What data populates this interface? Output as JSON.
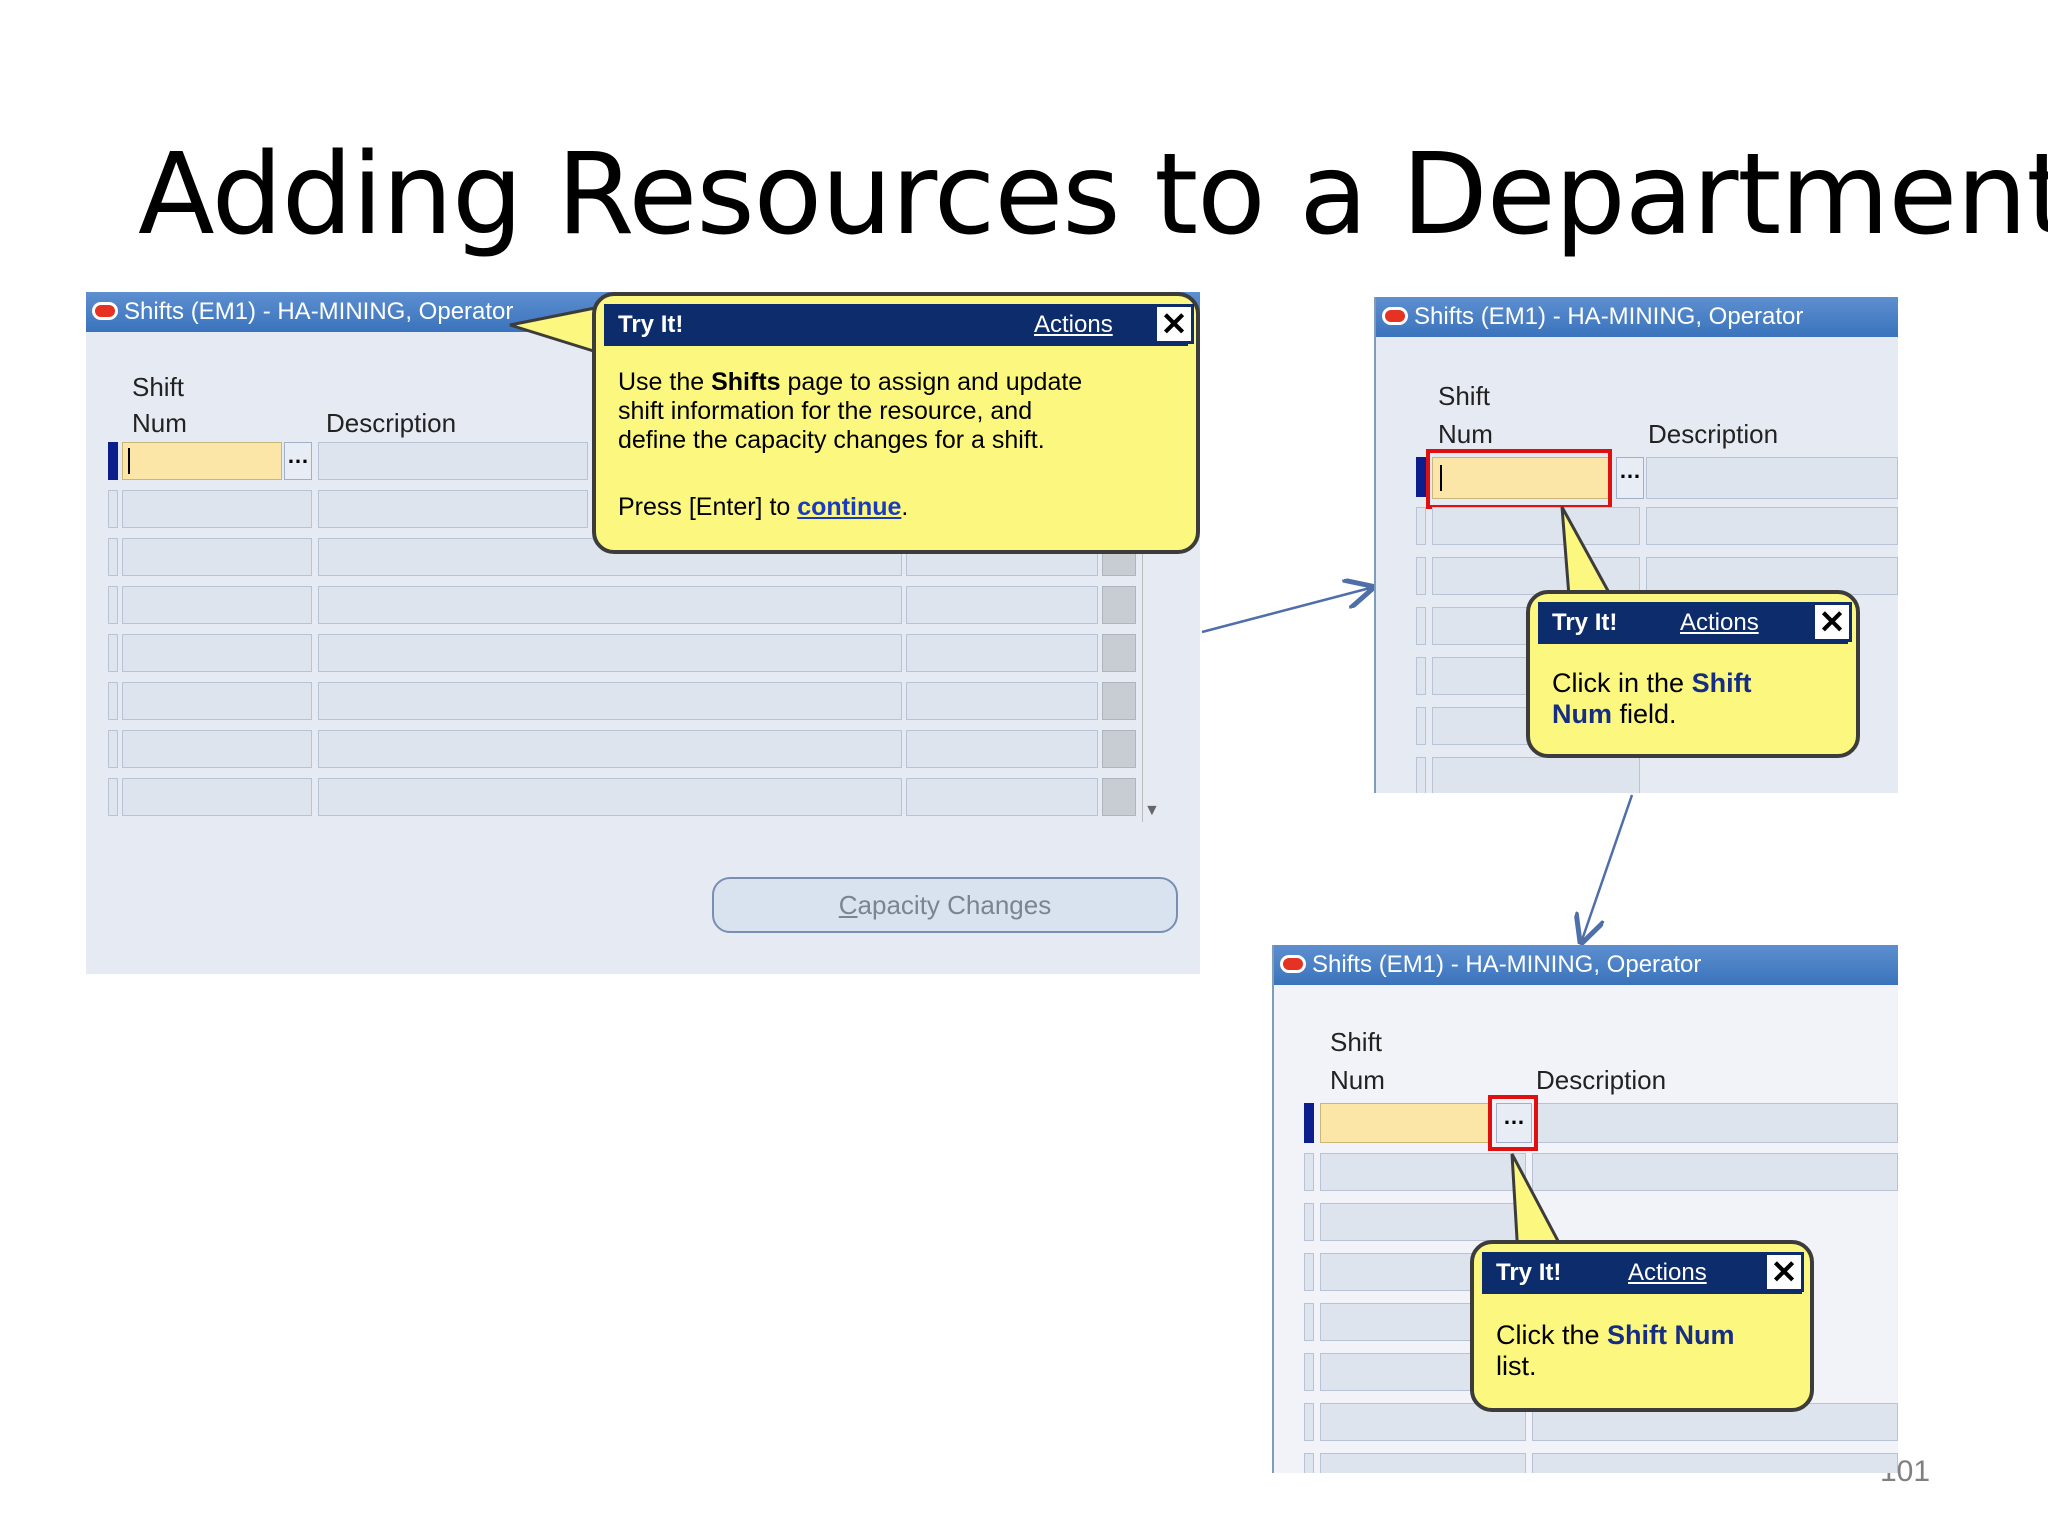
{
  "slide": {
    "title": "Adding Resources to a Department",
    "page_number": "101"
  },
  "window": {
    "title": "Shifts (EM1) - HA-MINING, Operator"
  },
  "columns": {
    "shift": "Shift",
    "num": "Num",
    "description": "Description"
  },
  "lov_button": "…",
  "capacity_button": {
    "prefix": "C",
    "rest": "apacity Changes"
  },
  "bubbles": {
    "step1": {
      "head": "Try It!",
      "actions": "Actions",
      "close": "✕",
      "l1a": "Use the ",
      "l1b": "Shifts",
      "l1c": " page to assign and update",
      "l2": "shift information for the resource, and",
      "l3": "define the capacity changes for a shift.",
      "press_a": "Press [Enter] to ",
      "press_link": "continue",
      "press_b": "."
    },
    "step2": {
      "head": "Try It!",
      "actions": "Actions",
      "close": "✕",
      "a": "Click in the ",
      "b": "Shift",
      "c": "Num",
      "d": " field."
    },
    "step3": {
      "head": "Try It!",
      "actions": "Actions",
      "close": "✕",
      "a": "Click the ",
      "b": "Shift Num",
      "c": "list."
    }
  },
  "colors": {
    "accent": "#0d2c6b",
    "bubble": "#fbf77f",
    "highlight": "#e01010",
    "active_field": "#fbe6a8"
  }
}
